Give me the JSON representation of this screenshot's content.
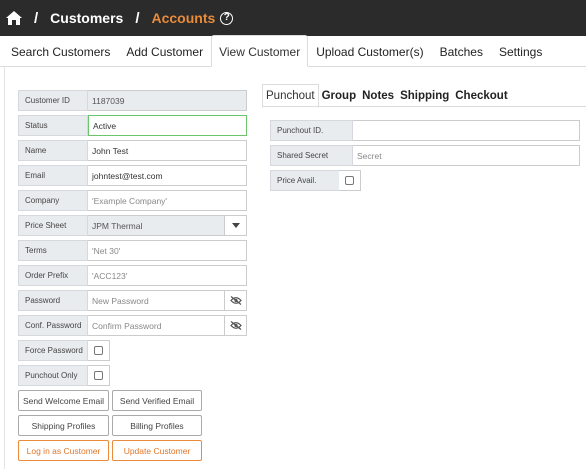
{
  "breadcrumb": {
    "separator": "/",
    "items": [
      "Customers",
      "Accounts"
    ],
    "help_icon": "?"
  },
  "nav": {
    "tabs": [
      "Search Customers",
      "Add Customer",
      "View Customer",
      "Upload Customer(s)",
      "Batches",
      "Settings"
    ],
    "active": "View Customer"
  },
  "form": {
    "customer_id": {
      "label": "Customer ID",
      "value": "1187039"
    },
    "status": {
      "label": "Status",
      "value": "Active"
    },
    "name": {
      "label": "Name",
      "value": "John Test"
    },
    "email": {
      "label": "Email",
      "value": "johntest@test.com"
    },
    "company": {
      "label": "Company",
      "placeholder": "'Example Company'"
    },
    "price_sheet": {
      "label": "Price Sheet",
      "value": "JPM Thermal"
    },
    "terms": {
      "label": "Terms",
      "placeholder": "'Net 30'"
    },
    "order_prefix": {
      "label": "Order Prefix",
      "placeholder": "'ACC123'"
    },
    "password": {
      "label": "Password",
      "placeholder": "New Password"
    },
    "conf_password": {
      "label": "Conf. Password",
      "placeholder": "Confirm Password"
    },
    "force_password": {
      "label": "Force Password"
    },
    "punchout_only": {
      "label": "Punchout Only"
    }
  },
  "buttons": {
    "send_welcome": "Send Welcome Email",
    "send_verified": "Send Verified Email",
    "shipping_profiles": "Shipping Profiles",
    "billing_profiles": "Billing Profiles",
    "login_as": "Log in as Customer",
    "update": "Update Customer"
  },
  "subtabs": {
    "tabs": [
      "Punchout",
      "Group",
      "Notes",
      "Shipping",
      "Checkout"
    ],
    "active": "Punchout"
  },
  "punchout": {
    "id": {
      "label": "Punchout ID.",
      "value": ""
    },
    "secret": {
      "label": "Shared Secret",
      "placeholder": "Secret"
    },
    "price_avail": {
      "label": "Price Avail."
    }
  },
  "colors": {
    "topbar": "#2b2b2b",
    "accent": "#e98b3a",
    "status_border": "#6cc46c"
  }
}
